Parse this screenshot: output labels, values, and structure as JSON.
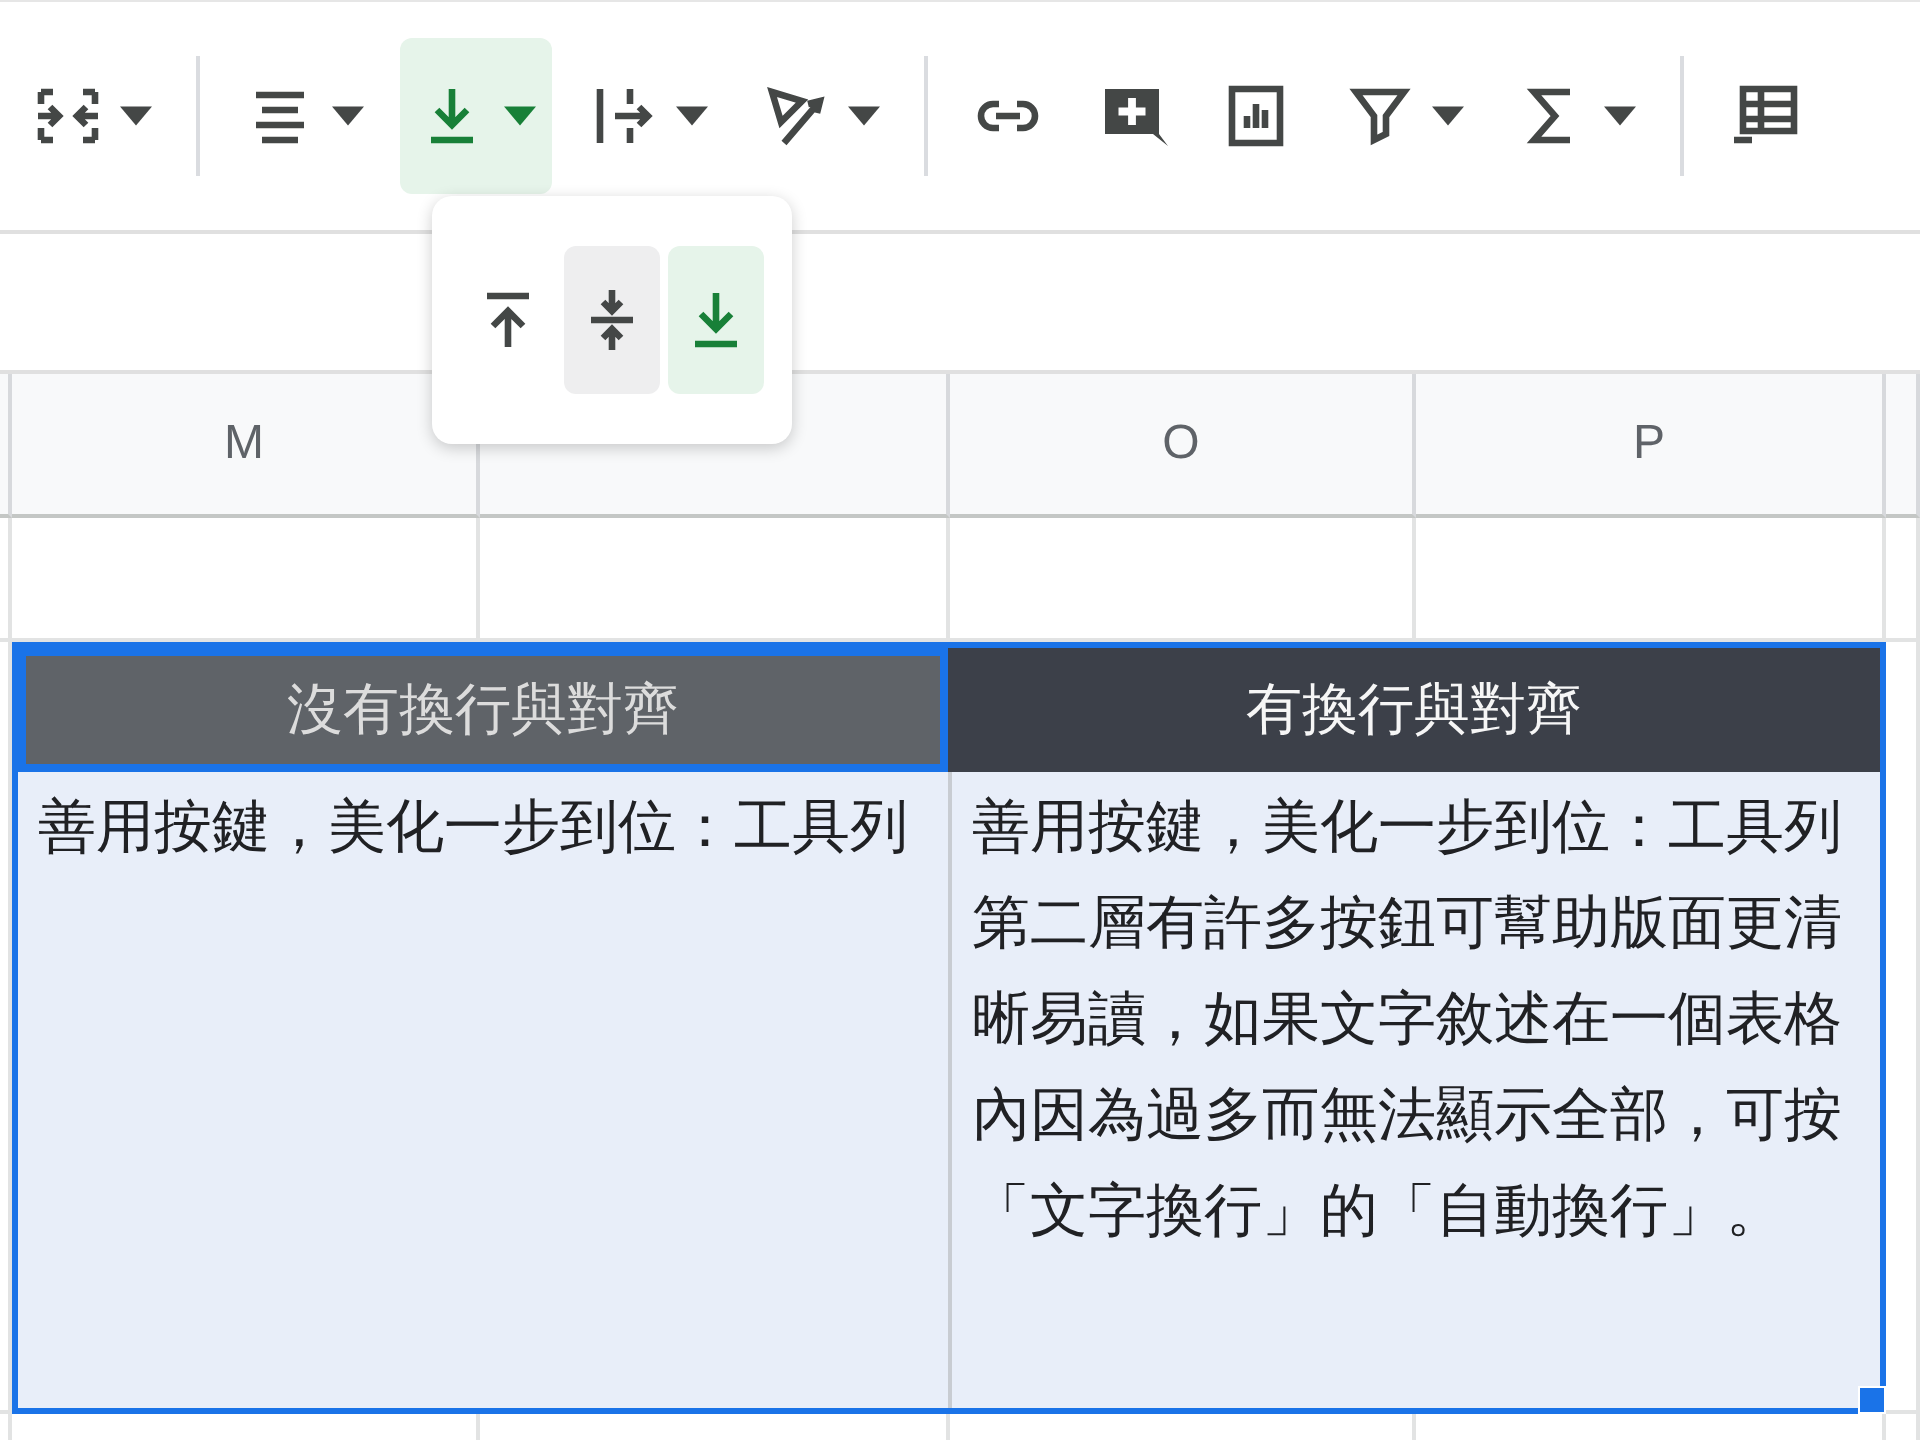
{
  "toolbar": [
    {
      "kind": "merge",
      "dropdown": true,
      "selected": false
    },
    {
      "kind": "divider"
    },
    {
      "kind": "halign",
      "dropdown": true,
      "selected": false
    },
    {
      "kind": "valign",
      "dropdown": true,
      "selected": true
    },
    {
      "kind": "wrap",
      "dropdown": true,
      "selected": false
    },
    {
      "kind": "rotate",
      "dropdown": true,
      "selected": false
    },
    {
      "kind": "divider"
    },
    {
      "kind": "link",
      "dropdown": false,
      "selected": false
    },
    {
      "kind": "comment",
      "dropdown": false,
      "selected": false
    },
    {
      "kind": "chart",
      "dropdown": false,
      "selected": false
    },
    {
      "kind": "filter",
      "dropdown": true,
      "selected": false
    },
    {
      "kind": "sum",
      "dropdown": true,
      "selected": false
    },
    {
      "kind": "divider"
    },
    {
      "kind": "table",
      "dropdown": false,
      "selected": false
    }
  ],
  "valign_menu": [
    {
      "kind": "top",
      "selected": false,
      "hovered": false
    },
    {
      "kind": "middle",
      "selected": false,
      "hovered": true
    },
    {
      "kind": "bottom",
      "selected": true,
      "hovered": false
    }
  ],
  "columns": [
    "M",
    null,
    "O",
    "P"
  ],
  "cells": [
    {
      "text": "沒有換行與對齊",
      "kind": "header",
      "selected": true,
      "color": "#5f6368"
    },
    {
      "text": "有換行與對齊",
      "kind": "header",
      "selected": false,
      "color": "#3c4049"
    },
    {
      "text": "善用按鍵，美化一步到位：工具列",
      "kind": "overflow"
    },
    {
      "text": "善用按鍵，美化一步到位：工具列第二層有許多按鈕可幫助版面更清晰易讀，如果文字敘述在一個表格內因為過多而無法顯示全部，可按「文字換行」的「自動換行」。",
      "kind": "wrap"
    }
  ]
}
